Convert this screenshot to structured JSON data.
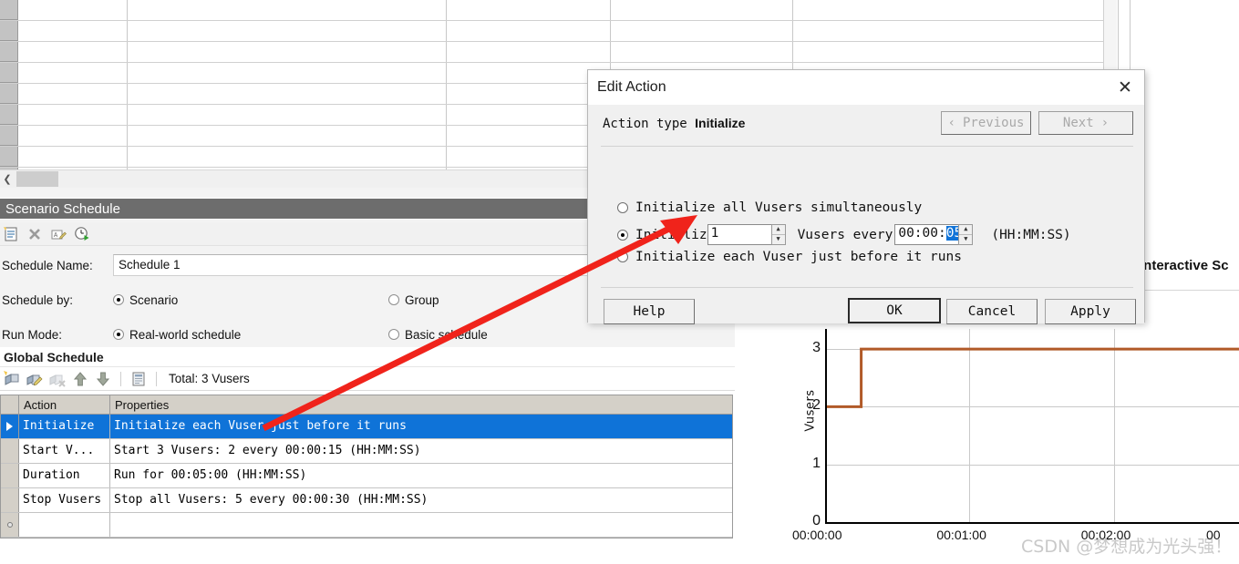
{
  "dialog": {
    "title": "Edit Action",
    "close_icon": "close-icon",
    "action_type_label": "Action type",
    "action_type_value": "Initialize",
    "previous_label": "Previous",
    "next_label": "Next",
    "prev_chevron": "‹",
    "next_chevron": "›",
    "options": [
      {
        "label": "Initialize all Vusers simultaneously",
        "selected": false
      },
      {
        "label_prefix": "Initializ",
        "selected": true,
        "vusers_value": "1",
        "mid_label": "Vusers every",
        "time_prefix": "00:00:",
        "time_selected": "05",
        "format_hint": "(HH:MM:SS)"
      },
      {
        "label": "Initialize each Vuser just before it runs",
        "selected": false
      }
    ],
    "buttons": {
      "help": "Help",
      "ok": "OK",
      "cancel": "Cancel",
      "apply": "Apply"
    }
  },
  "scenario_schedule": {
    "panel_title": "Scenario Schedule",
    "toolbar_icons": [
      "new-schedule-icon",
      "delete-icon",
      "rename-icon",
      "run-schedule-icon"
    ],
    "schedule_name_label": "Schedule Name:",
    "schedule_name_value": "Schedule 1",
    "schedule_by_label": "Schedule by:",
    "schedule_by_options": [
      {
        "label": "Scenario",
        "selected": true
      },
      {
        "label": "Group",
        "selected": false
      }
    ],
    "run_mode_label": "Run Mode:",
    "run_mode_options": [
      {
        "label": "Real-world schedule",
        "selected": true
      },
      {
        "label": "Basic schedule",
        "selected": false
      }
    ]
  },
  "global_schedule": {
    "panel_title": "Global Schedule",
    "toolbar_icons": [
      "add-action-icon",
      "edit-action-icon",
      "delete-action-icon",
      "move-up-icon",
      "move-down-icon",
      "grid-view-icon"
    ],
    "total_label": "Total: 3 Vusers",
    "columns": [
      "Action",
      "Properties"
    ],
    "rows": [
      {
        "action": "Initialize",
        "properties": "Initialize each Vuser just before it runs",
        "selected": true
      },
      {
        "action": "Start  V...",
        "properties": "Start 3 Vusers: 2 every 00:00:15 (HH:MM:SS)",
        "selected": false
      },
      {
        "action": "Duration",
        "properties": "Run for 00:05:00 (HH:MM:SS)",
        "selected": false
      },
      {
        "action": "Stop Vusers",
        "properties": "Stop all Vusers: 5 every 00:00:30 (HH:MM:SS)",
        "selected": false
      },
      {
        "action": "",
        "properties": "",
        "selected": false
      }
    ]
  },
  "chart_panel": {
    "header_title": "Interactive Sc",
    "watermark": "CSDN @梦想成为光头强！"
  },
  "chart_data": {
    "type": "line",
    "title": "",
    "xlabel": "",
    "ylabel": "Vusers",
    "ylim": [
      0,
      3.35
    ],
    "yticks": [
      0,
      1,
      2,
      3
    ],
    "xlim_seconds": [
      0,
      172
    ],
    "xticks": [
      "00:00:00",
      "00:01:00",
      "00:02:00",
      "00"
    ],
    "xtick_seconds": [
      0,
      60,
      120,
      172
    ],
    "grid": true,
    "legend": "none",
    "line_color": "#b15a28",
    "series": [
      {
        "name": "Vusers",
        "step": "post",
        "points": [
          {
            "t": 0,
            "v": 0
          },
          {
            "t": 0,
            "v": 2
          },
          {
            "t": 15,
            "v": 2
          },
          {
            "t": 15,
            "v": 3
          },
          {
            "t": 172,
            "v": 3
          }
        ]
      }
    ]
  },
  "colors": {
    "selection_blue": "#0f73d8",
    "panel_header_gray": "#6d6d6d",
    "chart_line": "#b15a28",
    "annotation_red": "#f0231b"
  }
}
